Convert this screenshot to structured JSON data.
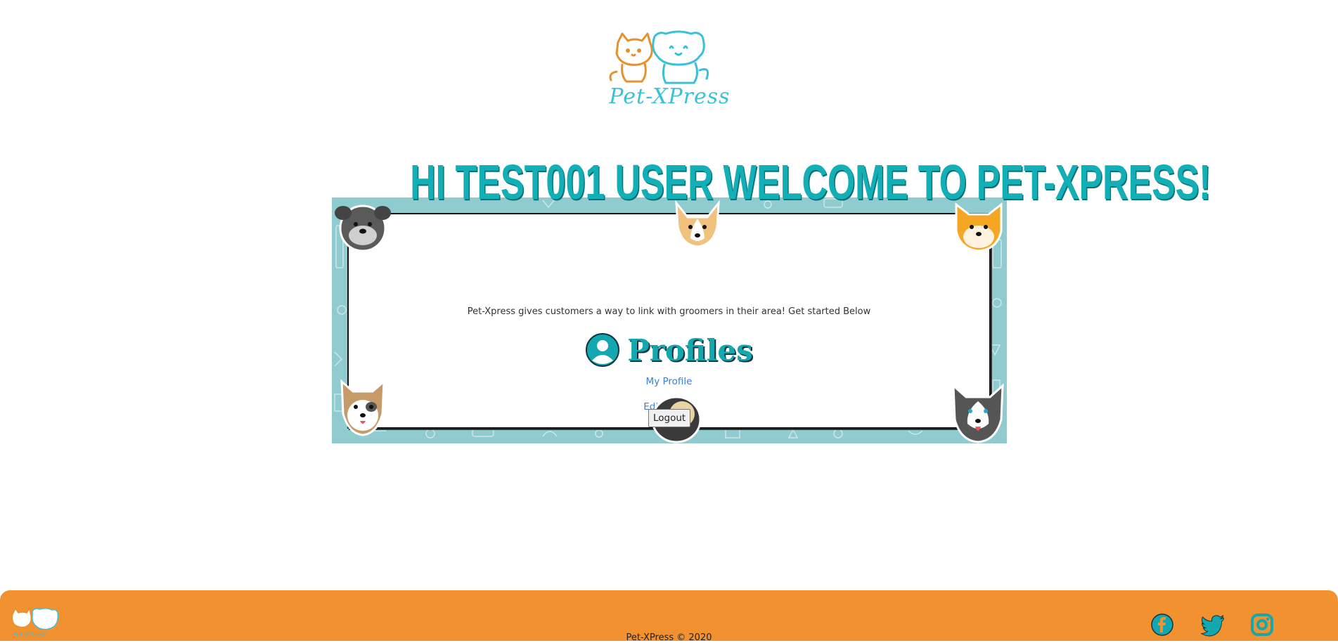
{
  "header": {
    "logo_text": "Pet-XPress"
  },
  "welcome_banner": {
    "text": "HI TEST001 USER WELCOME TO PET-XPRESS!"
  },
  "main_card": {
    "tagline": "Pet-Xpress gives customers a way to link with groomers in their area! Get started Below",
    "profiles_heading": "Profiles",
    "profiles_icon": "user-circle-icon",
    "links": {
      "my_profile": "My Profile",
      "edit_profile": "Edit Profile"
    },
    "logout_label": "Logout"
  },
  "footer": {
    "copyright": "Pet-XPress © 2020",
    "social": [
      "facebook-icon",
      "twitter-icon",
      "instagram-icon"
    ]
  },
  "colors": {
    "brand_teal": "#12b0b6",
    "frame_teal": "#8fcbcf",
    "footer_orange": "#f29130",
    "logo_cat_orange": "#e8902a",
    "logo_dog_blue": "#3cc0d8",
    "link_blue": "#3b7fd6"
  }
}
